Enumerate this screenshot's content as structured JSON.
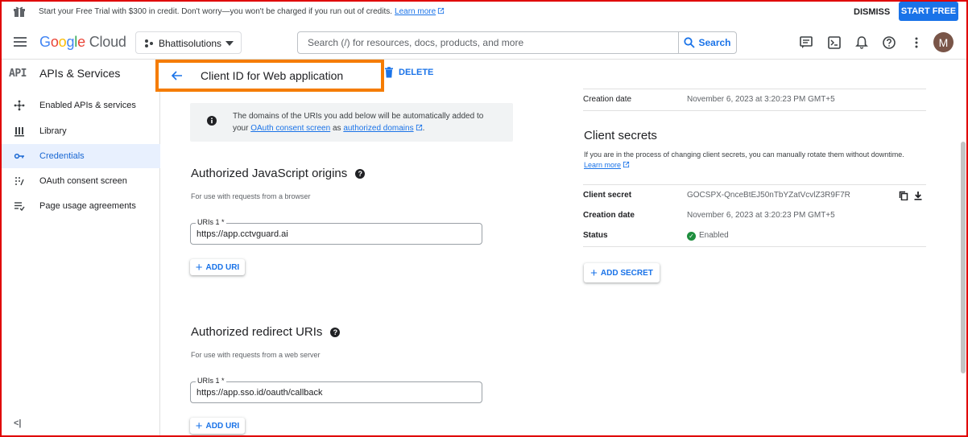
{
  "banner": {
    "message": "Start your Free Trial with $300 in credit. Don't worry—you won't be charged if you run out of credits.",
    "learn_more": "Learn more",
    "dismiss": "DISMISS",
    "start_free": "START FREE"
  },
  "header": {
    "logo_google": "Google",
    "logo_cloud": "Cloud",
    "project": "Bhattisolutions",
    "search_placeholder": "Search (/) for resources, docs, products, and more",
    "search_button": "Search",
    "avatar_letter": "M"
  },
  "sidebar": {
    "api_badge": "API",
    "title": "APIs & Services",
    "items": [
      {
        "label": "Enabled APIs & services",
        "icon": "hub-icon"
      },
      {
        "label": "Library",
        "icon": "library-icon"
      },
      {
        "label": "Credentials",
        "icon": "key-icon"
      },
      {
        "label": "OAuth consent screen",
        "icon": "consent-icon"
      },
      {
        "label": "Page usage agreements",
        "icon": "agreements-icon"
      }
    ],
    "active_index": 2,
    "collapse": "<|"
  },
  "page": {
    "title": "Client ID for Web application",
    "delete": "DELETE"
  },
  "info": {
    "line1": "The domains of the URIs you add below will be automatically added to",
    "line2_prefix": "your",
    "consent_link": "OAuth consent screen",
    "as": "as",
    "domains_link": "authorized domains",
    "period": "."
  },
  "js_origins": {
    "title": "Authorized JavaScript origins",
    "subtitle": "For use with requests from a browser",
    "field_label": "URIs 1 *",
    "field_value": "https://app.cctvguard.ai",
    "add_button": "ADD URI"
  },
  "redirect_uris": {
    "title": "Authorized redirect URIs",
    "subtitle": "For use with requests from a web server",
    "field_label": "URIs 1 *",
    "field_value": "https://app.sso.id/oauth/callback",
    "add_button": "ADD URI"
  },
  "right_panel": {
    "creation_label": "Creation date",
    "creation_value": "November 6, 2023 at 3:20:23 PM GMT+5",
    "secrets_title": "Client secrets",
    "secrets_desc": "If you are in the process of changing client secrets, you can manually rotate them without downtime.",
    "learn_more": "Learn more",
    "secret_label": "Client secret",
    "secret_value": "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",
    "secret_creation_label": "Creation date",
    "secret_creation_value": "November 6, 2023 at 3:20:23 PM GMT+5",
    "status_label": "Status",
    "status_value": "Enabled",
    "add_secret": "ADD SECRET"
  },
  "colors": {
    "accent": "#1a73e8",
    "highlight_border": "#f57c00",
    "frame": "#e00000",
    "enabled": "#1e8e3e"
  }
}
